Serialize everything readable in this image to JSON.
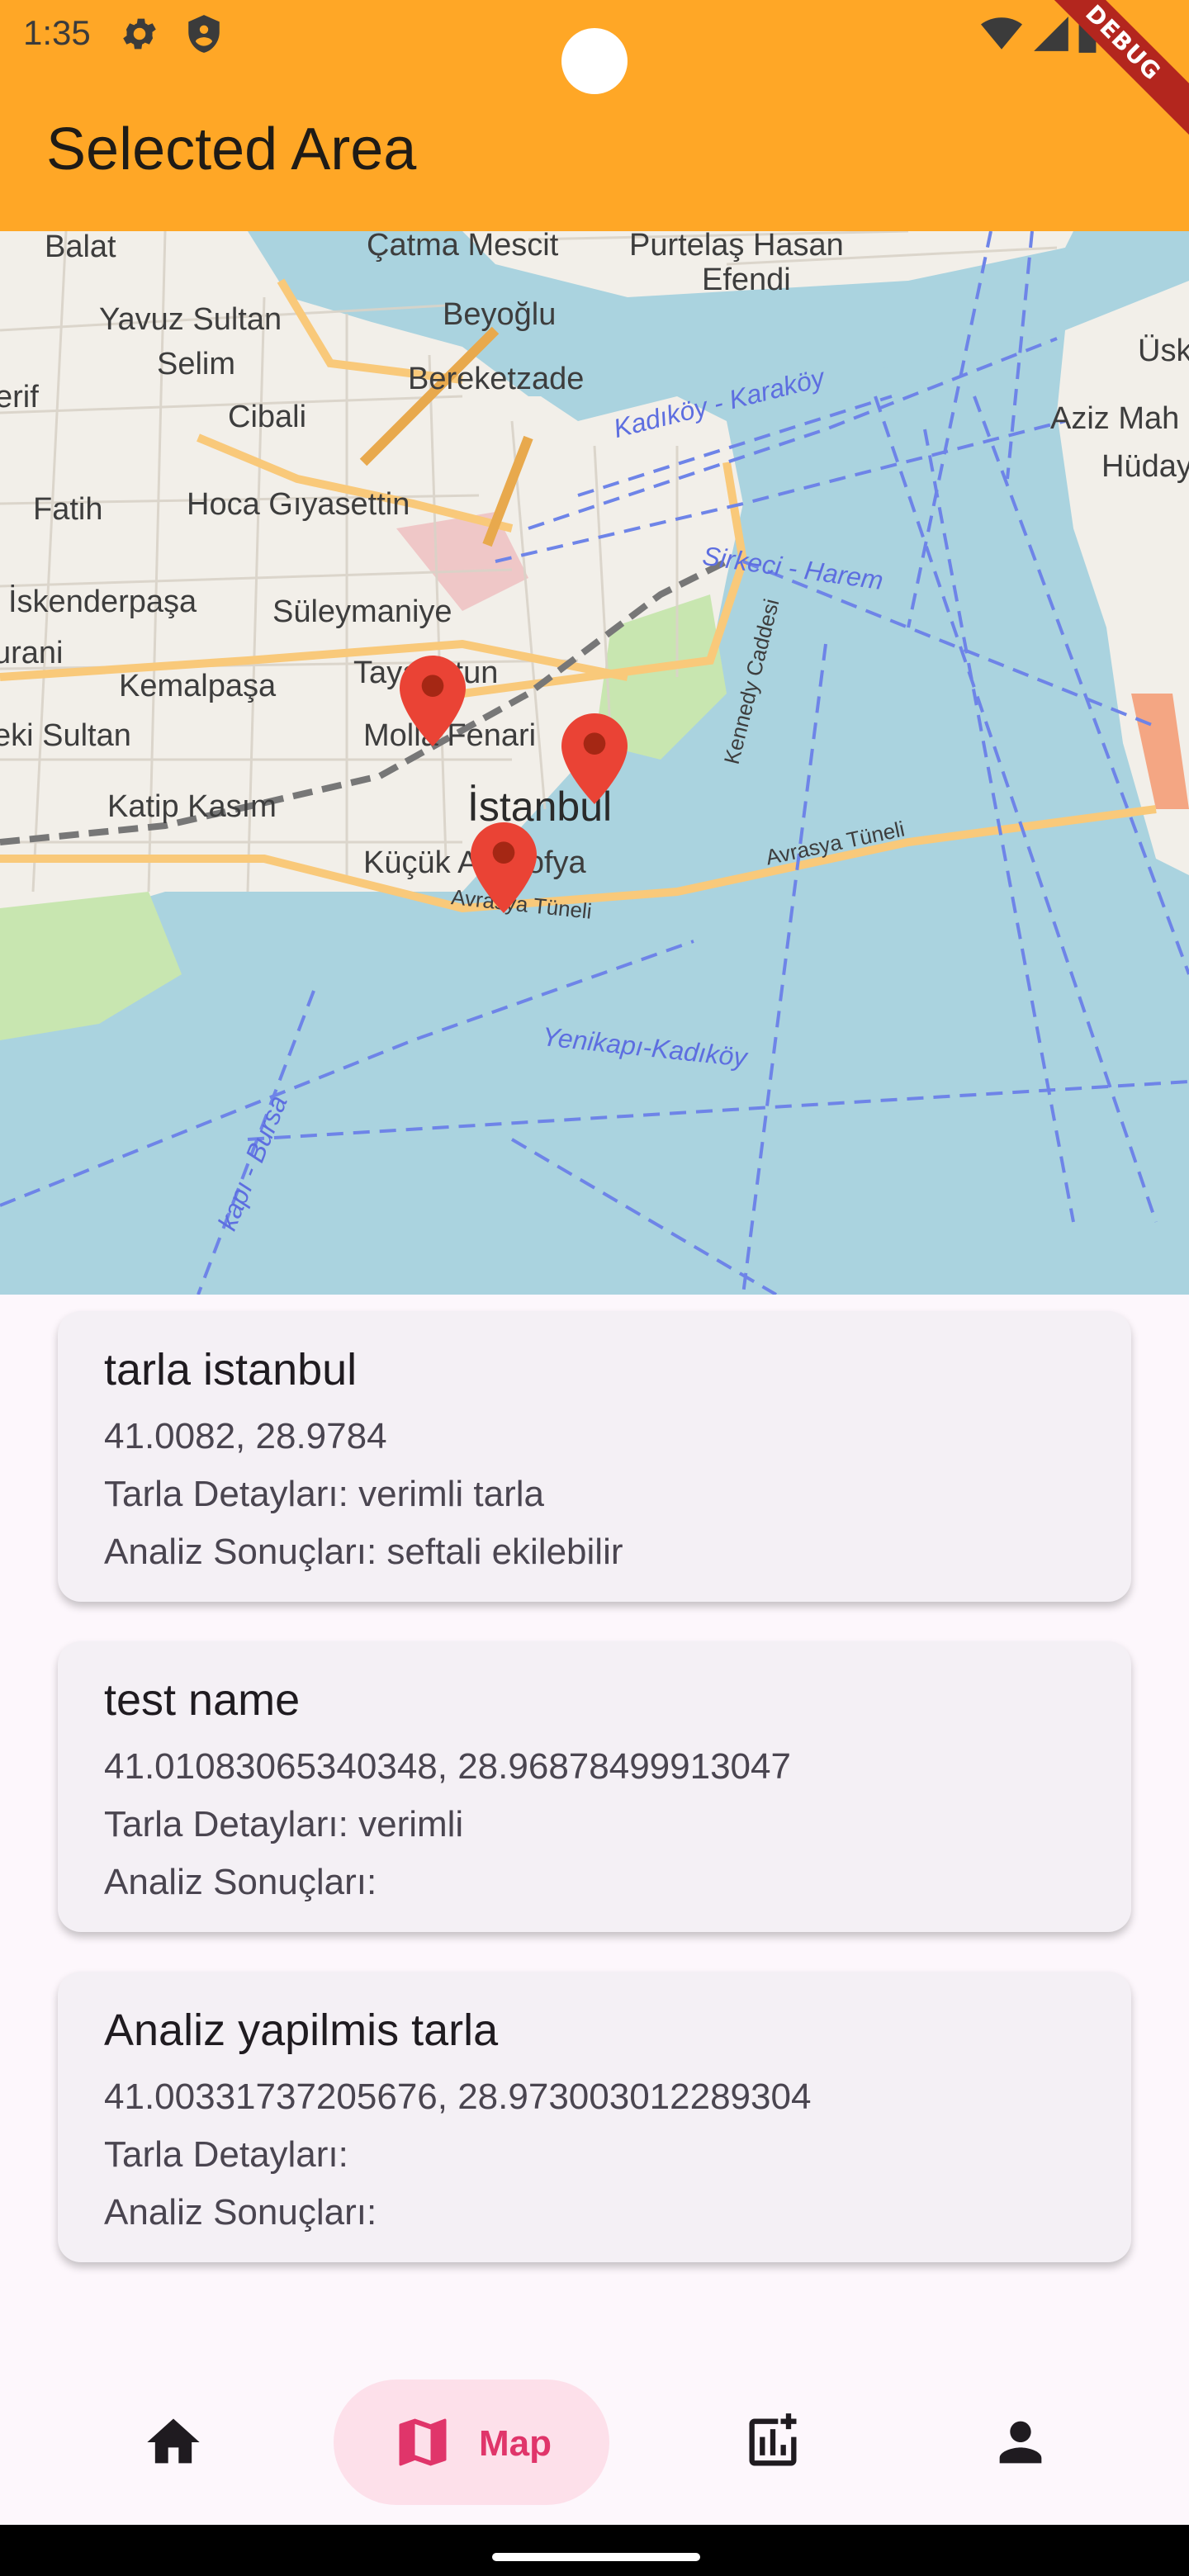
{
  "status_bar": {
    "time": "1:35",
    "icons": [
      "settings-gear-icon",
      "shield-icon",
      "wifi-icon",
      "cellular-signal-icon",
      "battery-icon"
    ],
    "debug_banner": "DEBUG"
  },
  "app_bar": {
    "title": "Selected Area",
    "background_color": "#ffa726"
  },
  "map": {
    "labels": {
      "balat": "Balat",
      "fatih": "Fatih",
      "yavuz": "Yavuz Sultan",
      "selim": "Selim",
      "cibali": "Cibali",
      "beyoglu": "Beyoğlu",
      "bereketzade": "Bereketzade",
      "catma": "Çatma Mescit",
      "purtelas": "Purtelaş Hasan",
      "efendi": "Efendi",
      "hoca": "Hoca Gıyasettin",
      "iskenderpasa": "İskenderpaşa",
      "suleymaniye": "Süleymaniye",
      "kemalpasa": "Kemalpaşa",
      "tayahatun": "Tayahatun",
      "mollafenari": "Molla Fenari",
      "istanbul": "İstanbul",
      "katipkasim": "Katip Kasım",
      "kucuk": "Küçük Ayasofya",
      "urani": "urani",
      "eki_sultan": "eki Sultan",
      "erif": "erif",
      "aziz": "Aziz Mah",
      "huday": "Hüday",
      "usk": "Üsk",
      "kadikoy_karakoy": "Kadıköy - Karaköy",
      "sirkeci": "Sirkeci - Harem",
      "yenikapi": "Yenikapı-Kadıköy",
      "avrasya": "Avrasya Tüneli",
      "avrasya2": "Avrasya Tüneli",
      "kennedy": "Kennedy Caddesi",
      "kapi_bursa": "kapı - Bursa"
    },
    "markers": [
      "map-pin-molla-fenari",
      "map-pin-istanbul",
      "map-pin-kucuk-ayasofya"
    ]
  },
  "areas": [
    {
      "name": "tarla istanbul",
      "coords": "41.0082, 28.9784",
      "details": "Tarla Detayları: verimli tarla",
      "analysis": "Analiz Sonuçları: seftali ekilebilir"
    },
    {
      "name": "test name",
      "coords": "41.01083065340348, 28.96878499913047",
      "details": "Tarla Detayları: verimli",
      "analysis": "Analiz Sonuçları:"
    },
    {
      "name": "Analiz yapilmis tarla",
      "coords": "41.00331737205676, 28.973003012289304",
      "details": "Tarla Detayları:",
      "analysis": "Analiz Sonuçları:"
    }
  ],
  "bottom_nav": {
    "items": [
      {
        "icon": "home-icon",
        "label": ""
      },
      {
        "icon": "map-icon",
        "label": "Map"
      },
      {
        "icon": "add-chart-icon",
        "label": ""
      },
      {
        "icon": "person-icon",
        "label": ""
      }
    ],
    "active_color": "#e0356a",
    "active_pill_color": "#fde0ea"
  }
}
